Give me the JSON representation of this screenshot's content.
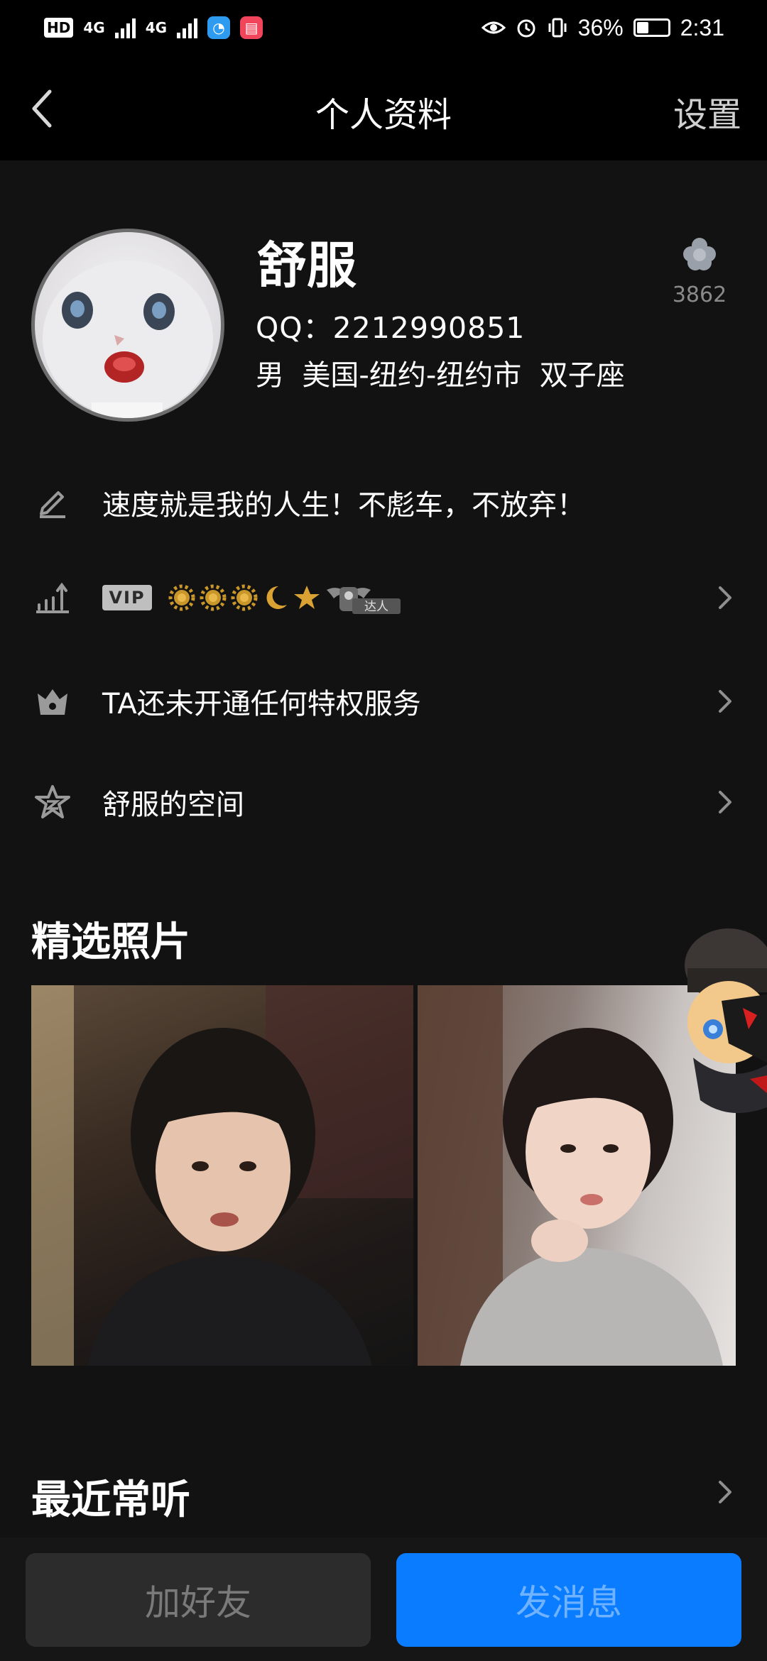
{
  "status_bar": {
    "hd_label": "HD",
    "sim1_label": "4G",
    "sim2_label": "4G",
    "battery_percent": "36%",
    "battery_level": 0.36,
    "time": "2:31"
  },
  "header": {
    "title": "个人资料",
    "settings_label": "设置"
  },
  "profile": {
    "name": "舒服",
    "qq": "QQ：2212990851",
    "info": "男  美国-纽约-纽约市  双子座",
    "like_count": "3862"
  },
  "rows": {
    "signature": "速度就是我的人生！不彪车，不放弃！",
    "vip_label": "VIP",
    "daren_label": "达人",
    "privilege": "TA还未开通任何特权服务",
    "space": "舒服的空间"
  },
  "sections": {
    "photos_title": "精选照片",
    "recent_title": "最近常听"
  },
  "bottom": {
    "add_friend": "加好友",
    "send_message": "发消息"
  },
  "colors": {
    "background": "#121212",
    "accent_blue": "#0a7cff",
    "icon_gray": "#9a9a9a"
  }
}
